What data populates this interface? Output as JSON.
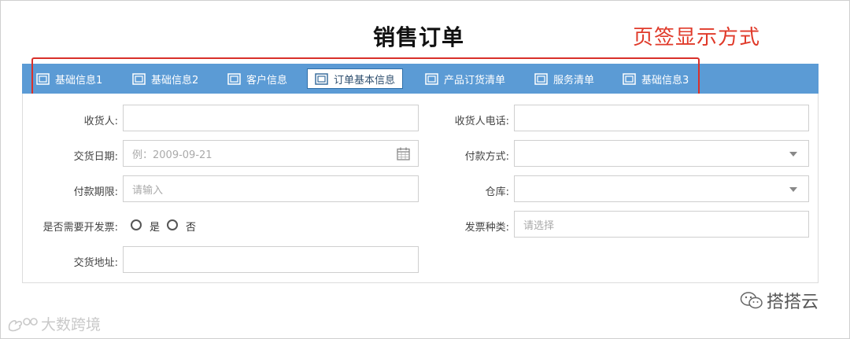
{
  "page": {
    "title": "销售订单",
    "annotation": "页签显示方式"
  },
  "tabs": [
    {
      "label": "基础信息1",
      "icon": "window-icon",
      "active": false
    },
    {
      "label": "基础信息2",
      "icon": "window-icon",
      "active": false
    },
    {
      "label": "客户信息",
      "icon": "window-icon",
      "active": false
    },
    {
      "label": "订单基本信息",
      "icon": "window-icon",
      "active": true
    },
    {
      "label": "产品订货清单",
      "icon": "window-icon",
      "active": false
    },
    {
      "label": "服务清单",
      "icon": "window-icon",
      "active": false
    },
    {
      "label": "基础信息3",
      "icon": "window-icon",
      "active": false
    }
  ],
  "form": {
    "receiver": {
      "label": "收货人:",
      "value": ""
    },
    "receiver_phone": {
      "label": "收货人电话:",
      "value": ""
    },
    "delivery_date": {
      "label": "交货日期:",
      "placeholder": "例：2009-09-21",
      "icon": "calendar-icon"
    },
    "payment_method": {
      "label": "付款方式:",
      "value": ""
    },
    "payment_term": {
      "label": "付款期限:",
      "placeholder": "请输入"
    },
    "warehouse": {
      "label": "仓库:",
      "value": ""
    },
    "need_invoice": {
      "label": "是否需要开发票:",
      "options": [
        "是",
        "否"
      ]
    },
    "invoice_type": {
      "label": "发票种类:",
      "placeholder": "请选择"
    },
    "delivery_address": {
      "label": "交货地址:",
      "value": ""
    }
  },
  "watermarks": {
    "left": "大数跨境",
    "right": "搭搭云"
  },
  "colors": {
    "tab_bar": "#5b9bd5",
    "annotation": "#e03a2a",
    "highlight_border": "#d9302a"
  }
}
